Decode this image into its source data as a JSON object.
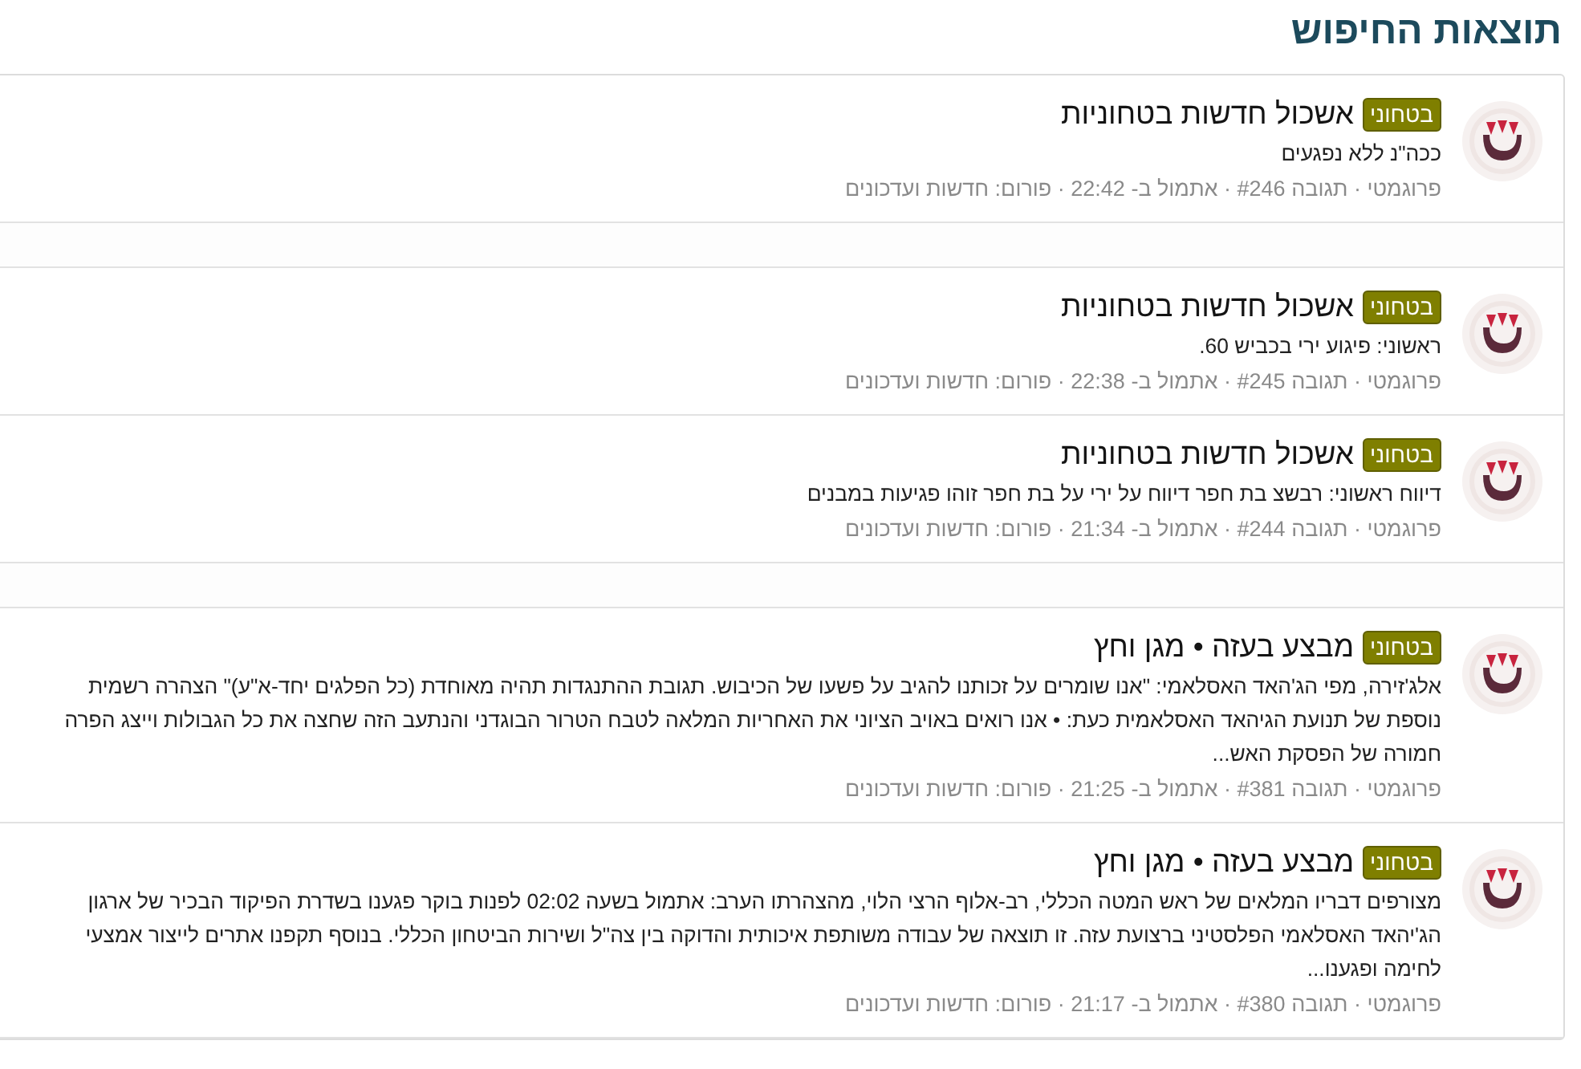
{
  "heading": "תוצאות החיפוש",
  "results": [
    {
      "kind": "result",
      "badge": "בטחוני",
      "title": "אשכול חדשות בטחוניות",
      "snippet": [
        "ככה\"נ ללא נפגעים"
      ],
      "meta": "פרוגמטי · תגובה #246 · אתמול ב- 22:42 · פורום: חדשות ועדכונים"
    },
    {
      "kind": "gap"
    },
    {
      "kind": "result",
      "badge": "בטחוני",
      "title": "אשכול חדשות בטחוניות",
      "snippet": [
        "ראשוני: פיגוע ירי בכביש 60."
      ],
      "meta": "פרוגמטי · תגובה #245 · אתמול ב- 22:38 · פורום: חדשות ועדכונים"
    },
    {
      "kind": "result",
      "badge": "בטחוני",
      "title": "אשכול חדשות בטחוניות",
      "snippet": [
        "דיווח ראשוני: רבשצ בת חפר דיווח על ירי על בת חפר זוהו פגיעות במבנים"
      ],
      "meta": "פרוגמטי · תגובה #244 · אתמול ב- 21:34 · פורום: חדשות ועדכונים"
    },
    {
      "kind": "gap"
    },
    {
      "kind": "result",
      "badge": "בטחוני",
      "title": "מבצע בעזה • מגן וחץ",
      "snippet": [
        "אלג'זירה, מפי הג'האד האסלאמי: \"אנו שומרים על זכותנו להגיב על פשעו של הכיבוש. תגובת ההתנגדות תהיה מאוחדת (כל הפלגים יחד-א\"ע)\" הצהרה רשמית",
        "נוספת של תנועת הגיהאד האסלאמית כעת: • אנו רואים באויב הציוני את האחריות המלאה לטבח הטרור הבוגדני והנתעב הזה שחצה את כל הגבולות וייצג הפרה",
        "חמורה של הפסקת האש..."
      ],
      "meta": "פרוגמטי · תגובה #381 · אתמול ב- 21:25 · פורום: חדשות ועדכונים"
    },
    {
      "kind": "result",
      "badge": "בטחוני",
      "title": "מבצע בעזה • מגן וחץ",
      "snippet": [
        "מצורפים דבריו המלאים של ראש המטה הכללי, רב-אלוף הרצי הלוי, מהצהרתו הערב: אתמול בשעה 02:02 לפנות בוקר פגענו בשדרת הפיקוד הבכיר של ארגון",
        "הג'יהאד האסלאמי הפלסטיני ברצועת עזה. זו תוצאה של עבודה משותפת איכותית והדוקה בין צה\"ל ושירות הביטחון הכללי. בנוסף תקפנו אתרים לייצור אמצעי",
        "לחימה ופגענו..."
      ],
      "meta": "פרוגמטי · תגובה #380 · אתמול ב- 21:17 · פורום: חדשות ועדכונים"
    }
  ]
}
